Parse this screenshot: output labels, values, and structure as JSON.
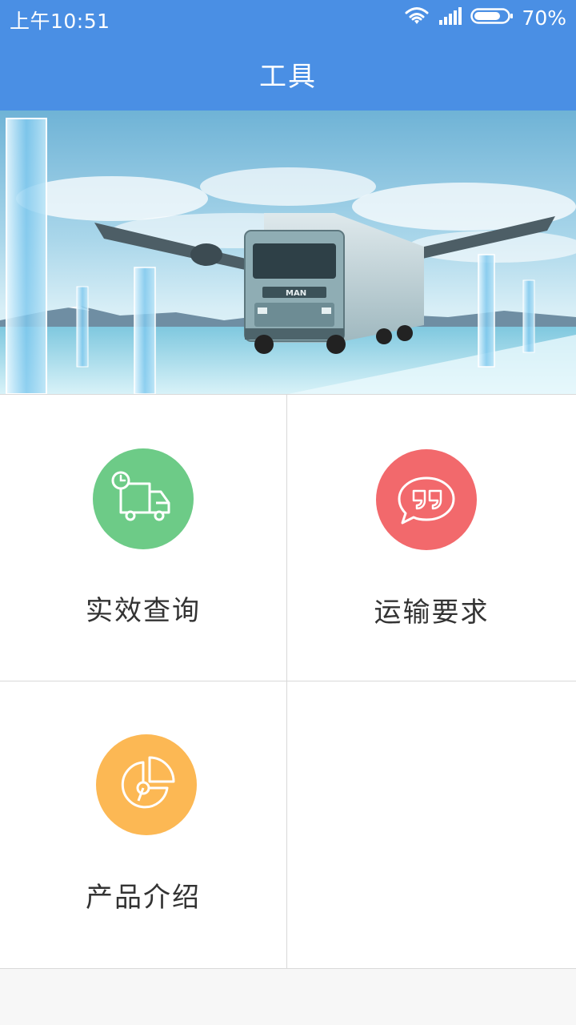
{
  "status_bar": {
    "time": "上午10:51",
    "battery": "70%",
    "icons": [
      "wifi-icon",
      "signal-icon",
      "battery-icon"
    ]
  },
  "header": {
    "title": "工具"
  },
  "banner": {
    "description_icon": "truck-airplane-banner-image"
  },
  "tools": [
    {
      "label": "实效查询",
      "icon": "delivery-truck-clock-icon",
      "color": "#6dcb87"
    },
    {
      "label": "运输要求",
      "icon": "quote-bubble-icon",
      "color": "#f2696c"
    },
    {
      "label": "产品介绍",
      "icon": "pie-chart-icon",
      "color": "#fcb854"
    }
  ],
  "colors": {
    "accent": "#4a8fe4"
  }
}
